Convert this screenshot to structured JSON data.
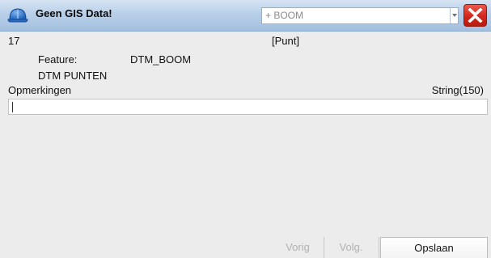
{
  "window": {
    "title": "Geen GIS Data!",
    "feature_select_value": "+ BOOM",
    "close_icon": "close-x-icon",
    "app_icon": "hard-hat-icon"
  },
  "record": {
    "id": "17",
    "geometry_type": "[Punt]",
    "feature_label": "Feature:",
    "feature_value": "DTM_BOOM",
    "layer_name": "DTM PUNTEN"
  },
  "field": {
    "label": "Opmerkingen",
    "type": "String(150)",
    "value": ""
  },
  "buttons": {
    "prev_label": "Vorig",
    "next_label": "Volg.",
    "save_label": "Opslaan"
  },
  "colors": {
    "titlebar": "#b8cfe8",
    "close_button": "#d0281c",
    "background": "#ececec",
    "disabled_text": "#b2b2b2"
  }
}
